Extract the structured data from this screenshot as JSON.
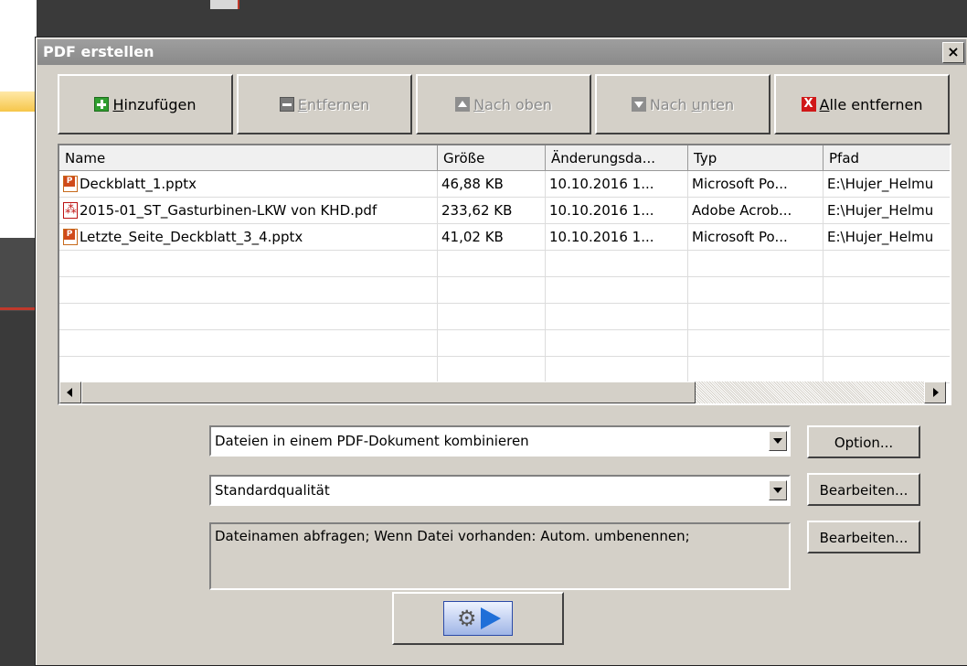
{
  "dialog": {
    "title": "PDF erstellen",
    "close_label": "×"
  },
  "toolbar": {
    "add": {
      "prefix": "",
      "mnemonic": "H",
      "rest": "inzufügen",
      "enabled": true
    },
    "remove": {
      "mnemonic": "E",
      "rest": "ntfernen",
      "enabled": false
    },
    "up_pre": "N",
    "up_mn": "",
    "up_rest": "ach oben",
    "down_pre": "Nach ",
    "down_mn": "u",
    "down_rest": "nten",
    "clear": {
      "mnemonic": "A",
      "rest": "lle entfernen",
      "enabled": true
    }
  },
  "files": {
    "columns": [
      "Name",
      "Größe",
      "Änderungsda...",
      "Typ",
      "Pfad"
    ],
    "rows": [
      {
        "icon": "powerpoint-file-icon",
        "name": "Deckblatt_1.pptx",
        "size": "46,88 KB",
        "modified": "10.10.2016 1...",
        "type": "Microsoft Po...",
        "path": "E:\\Hujer_Helmu"
      },
      {
        "icon": "pdf-file-icon",
        "name": "2015-01_ST_Gasturbinen-LKW von KHD.pdf",
        "size": "233,62 KB",
        "modified": "10.10.2016 1...",
        "type": "Adobe Acrob...",
        "path": "E:\\Hujer_Helmu"
      },
      {
        "icon": "powerpoint-file-icon",
        "name": "Letzte_Seite_Deckblatt_3_4.pptx",
        "size": "41,02 KB",
        "modified": "10.10.2016 1...",
        "type": "Microsoft Po...",
        "path": "E:\\Hujer_Helmu"
      }
    ]
  },
  "combine_mode": {
    "value": "Dateien in einem PDF-Dokument kombinieren"
  },
  "quality": {
    "value": "Standardqualität"
  },
  "naming_info": "Dateinamen abfragen; Wenn Datei vorhanden: Autom. umbenennen;",
  "buttons": {
    "option": "Option...",
    "edit_quality": "Bearbeiten...",
    "edit_naming": "Bearbeiten..."
  },
  "icons": {
    "run": "gear-arrow-icon",
    "add": "plus-icon",
    "remove": "minus-icon",
    "up": "arrow-up-icon",
    "down": "arrow-down-icon",
    "clear": "red-x-icon"
  },
  "colors": {
    "title_bar": "#8a8a8a",
    "dialog_bg": "#d4d0c8",
    "clear_icon": "#d01818",
    "add_icon": "#2f9e2f",
    "run_arrow": "#1f6fd8"
  }
}
